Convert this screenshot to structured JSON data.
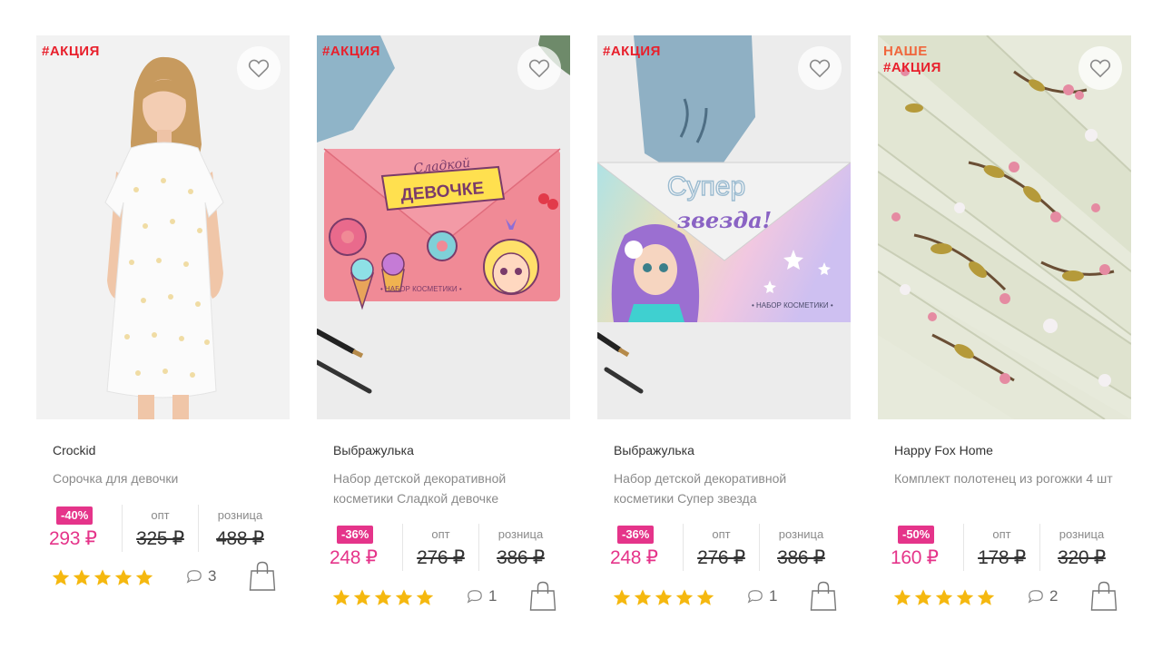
{
  "products": [
    {
      "tag_lines": [
        "#АКЦИЯ"
      ],
      "brand": "Crockid",
      "title": "Сорочка для девочки",
      "discount": "-40%",
      "price": "293 ₽",
      "opt_label": "опт",
      "opt_price": "325 ₽",
      "retail_label": "розница",
      "retail_price": "488 ₽",
      "rating": 5,
      "comments": "3"
    },
    {
      "tag_lines": [
        "#АКЦИЯ"
      ],
      "brand": "Выбражулька",
      "title": "Набор детской декоративной косметики Сладкой девочке",
      "discount": "-36%",
      "price": "248 ₽",
      "opt_label": "опт",
      "opt_price": "276 ₽",
      "retail_label": "розница",
      "retail_price": "386 ₽",
      "rating": 5,
      "comments": "1",
      "image_text": {
        "top": "Сладкой",
        "main": "ДЕВОЧКЕ",
        "caption": "• НАБОР КОСМЕТИКИ •"
      }
    },
    {
      "tag_lines": [
        "#АКЦИЯ"
      ],
      "brand": "Выбражулька",
      "title": "Набор детской декоративной косметики Супер звезда",
      "discount": "-36%",
      "price": "248 ₽",
      "opt_label": "опт",
      "opt_price": "276 ₽",
      "retail_label": "розница",
      "retail_price": "386 ₽",
      "rating": 5,
      "comments": "1",
      "image_text": {
        "top": "Супер",
        "main": "звезда!",
        "caption": "• НАБОР КОСМЕТИКИ •"
      }
    },
    {
      "tag_lines": [
        "НАШЕ",
        "#АКЦИЯ"
      ],
      "brand": "Happy Fox Home",
      "title": "Комплект полотенец из рогожки 4 шт",
      "discount": "-50%",
      "price": "160 ₽",
      "opt_label": "опт",
      "opt_price": "178 ₽",
      "retail_label": "розница",
      "retail_price": "320 ₽",
      "rating": 5,
      "comments": "2"
    }
  ],
  "colors": {
    "tag": "#e8202c",
    "accent_pink": "#e5348a",
    "star": "#f5b80f"
  },
  "icons": {
    "favorite": "heart-outline-icon",
    "comments": "speech-bubble-icon",
    "cart": "shopping-bag-icon",
    "rating": "star-icon"
  }
}
